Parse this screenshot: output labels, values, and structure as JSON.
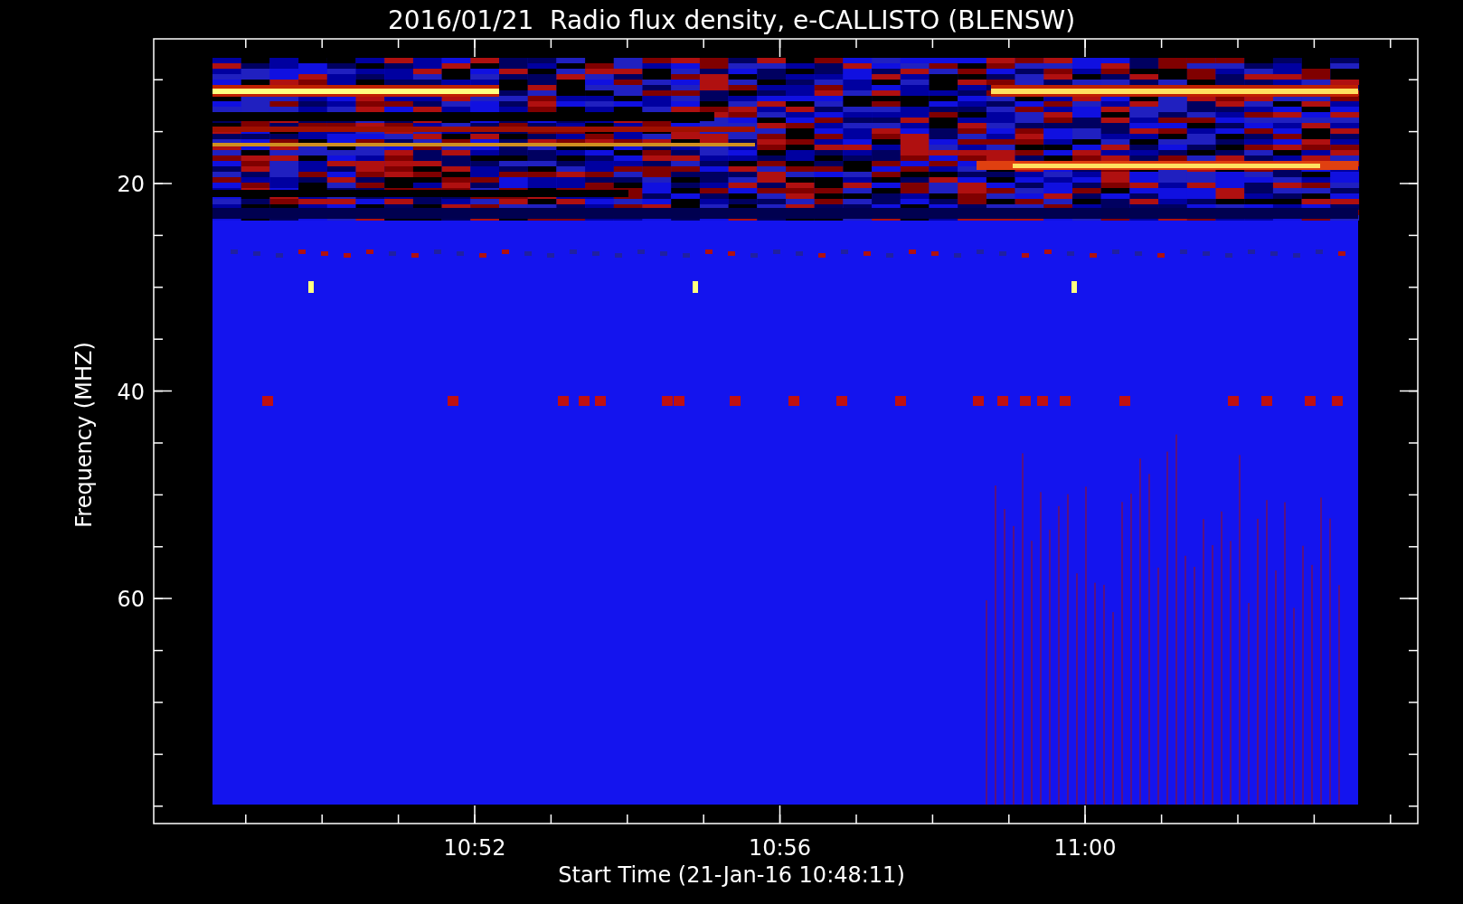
{
  "title": "2016/01/21  Radio flux density, e-CALLISTO (BLENSW)",
  "y_axis": {
    "label": "Frequency (MHZ)",
    "ticks": [
      "20",
      "40",
      "60"
    ]
  },
  "x_axis": {
    "label": "Start Time (21-Jan-16 10:48:11)",
    "ticks": [
      "10:52",
      "10:56",
      "11:00"
    ]
  }
}
